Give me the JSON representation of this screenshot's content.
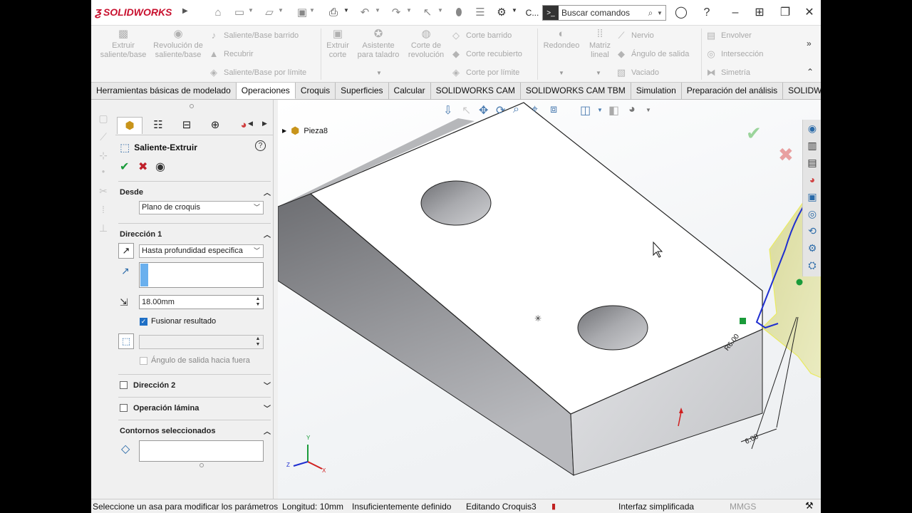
{
  "app": {
    "name": "SOLIDWORKS"
  },
  "search": {
    "placeholder": "Buscar comandos",
    "truncated_label": "C..."
  },
  "ribbon": {
    "big": [
      {
        "label": "Extruir saliente/base"
      },
      {
        "label": "Revolución de saliente/base"
      },
      {
        "label": "Extruir corte"
      },
      {
        "label": "Asistente para taladro"
      },
      {
        "label": "Corte de revolución"
      },
      {
        "label": "Redondeo"
      },
      {
        "label": "Matriz lineal"
      }
    ],
    "small": [
      {
        "label": "Saliente/Base barrido"
      },
      {
        "label": "Recubrir"
      },
      {
        "label": "Saliente/Base por límite"
      },
      {
        "label": "Corte barrido"
      },
      {
        "label": "Corte recubierto"
      },
      {
        "label": "Corte por límite"
      },
      {
        "label": "Nervio"
      },
      {
        "label": "Ángulo de salida"
      },
      {
        "label": "Vaciado"
      },
      {
        "label": "Envolver"
      },
      {
        "label": "Intersección"
      },
      {
        "label": "Simetría"
      }
    ]
  },
  "tabs": [
    {
      "label": "Herramientas básicas de modelado"
    },
    {
      "label": "Operaciones",
      "active": true
    },
    {
      "label": "Croquis"
    },
    {
      "label": "Superficies"
    },
    {
      "label": "Calcular"
    },
    {
      "label": "SOLIDWORKS CAM"
    },
    {
      "label": "SOLIDWORKS CAM TBM"
    },
    {
      "label": "Simulation"
    },
    {
      "label": "Preparación del análisis"
    },
    {
      "label": "SOLIDWOR..."
    }
  ],
  "property_manager": {
    "title": "Saliente-Extruir",
    "from": {
      "header": "Desde",
      "value": "Plano de croquis"
    },
    "direction1": {
      "header": "Dirección 1",
      "end_condition": "Hasta profundidad especifica",
      "depth": "18.00mm",
      "merge_label": "Fusionar resultado",
      "merge_checked": true,
      "draft_label": "Ángulo de salida hacia fuera"
    },
    "direction2": {
      "header": "Dirección 2"
    },
    "thin": {
      "header": "Operación lámina"
    },
    "contours": {
      "header": "Contornos seleccionados"
    }
  },
  "viewport": {
    "tree_item": "Pieza8",
    "dimension_radius": "R6.00",
    "dimension_length": "6.00",
    "axes": {
      "x": "X",
      "y": "Y",
      "z": "Z"
    }
  },
  "status": {
    "message": "Seleccione un asa para modificar los parámetros",
    "length": "Longitud: 10mm",
    "definition": "Insuficientemente definido",
    "editing": "Editando Croquis3",
    "interface": "Interfaz simplificada",
    "units": "MMGS"
  },
  "colors": {
    "brand": "#c8102e",
    "accept": "#1a9b3a",
    "cancel": "#c0202a",
    "sketch": "#1f2fd0",
    "selection": "#e6e600"
  }
}
